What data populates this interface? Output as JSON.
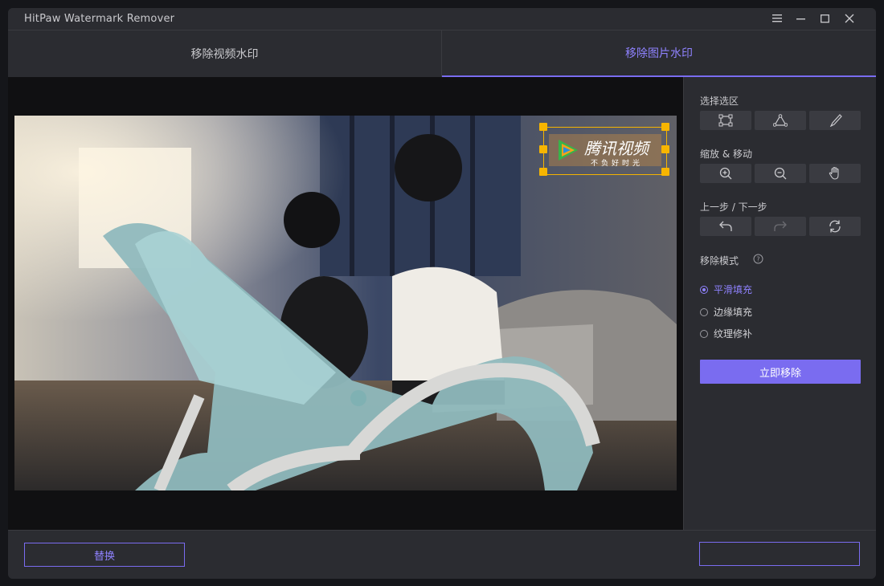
{
  "app": {
    "title": "HitPaw Watermark Remover"
  },
  "tabs": [
    {
      "label": "移除视频水印",
      "active": false
    },
    {
      "label": "移除图片水印",
      "active": true
    }
  ],
  "panel": {
    "select_label": "选择选区",
    "select_tools": [
      "rectangle-select-icon",
      "polygon-select-icon",
      "brush-select-icon"
    ],
    "zoom_label": "缩放 & 移动",
    "zoom_tools": [
      "zoom-in-icon",
      "zoom-out-icon",
      "hand-pan-icon"
    ],
    "history_label": "上一步 / 下一步",
    "history_tools": [
      "undo-icon",
      "redo-icon",
      "reset-icon"
    ],
    "mode_label": "移除模式",
    "modes": [
      {
        "label": "平滑填充",
        "selected": true
      },
      {
        "label": "边缘填充",
        "selected": false
      },
      {
        "label": "纹理修补",
        "selected": false
      }
    ],
    "remove_label": "立即移除"
  },
  "watermark": {
    "title": "腾讯视频",
    "tagline": "不负好时光"
  },
  "footer": {
    "replace_label": "替换"
  },
  "colors": {
    "accent": "#7a6cf0",
    "handle": "#f7b500",
    "window_bg": "#2b2c31"
  }
}
